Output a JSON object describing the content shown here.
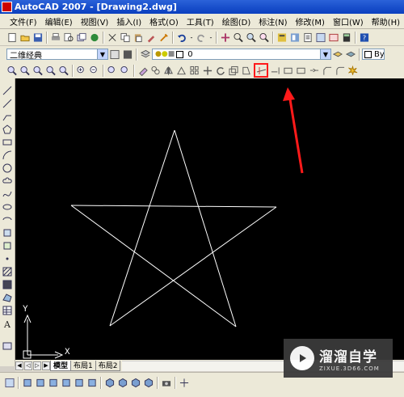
{
  "window": {
    "title": "AutoCAD 2007 - [Drawing2.dwg]"
  },
  "menubar": {
    "items": [
      "文件(F)",
      "编辑(E)",
      "视图(V)",
      "插入(I)",
      "格式(O)",
      "工具(T)",
      "绘图(D)",
      "标注(N)",
      "修改(M)",
      "窗口(W)",
      "帮助(H)"
    ]
  },
  "toolbar2": {
    "workspace_value": "二维经典",
    "layer_value": "0",
    "bylayer_value": "ByL"
  },
  "tabs": {
    "model": "模型",
    "layout1": "布局1",
    "layout2": "布局2"
  },
  "ucs": {
    "x_label": "X",
    "y_label": "Y"
  },
  "watermark": {
    "name": "溜溜自学",
    "url": "ZIXUE.3D66.COM"
  },
  "colors": {
    "canvas": "#000000",
    "highlight": "#ff1a1a",
    "titlebar": "#0a3fbf"
  },
  "icons": [
    "new-icon",
    "open-icon",
    "save-icon",
    "plot-icon",
    "preview-icon",
    "publish-icon",
    "cut-icon",
    "copy-icon",
    "paste-icon",
    "matchprop-icon",
    "undo-icon",
    "redo-icon",
    "pan-icon",
    "zoom-realtime-icon",
    "zoom-window-icon",
    "zoom-previous-icon",
    "properties-icon",
    "designcenter-icon",
    "toolpalettes-icon",
    "sheetset-icon",
    "markup-icon",
    "calc-icon",
    "help-icon"
  ]
}
